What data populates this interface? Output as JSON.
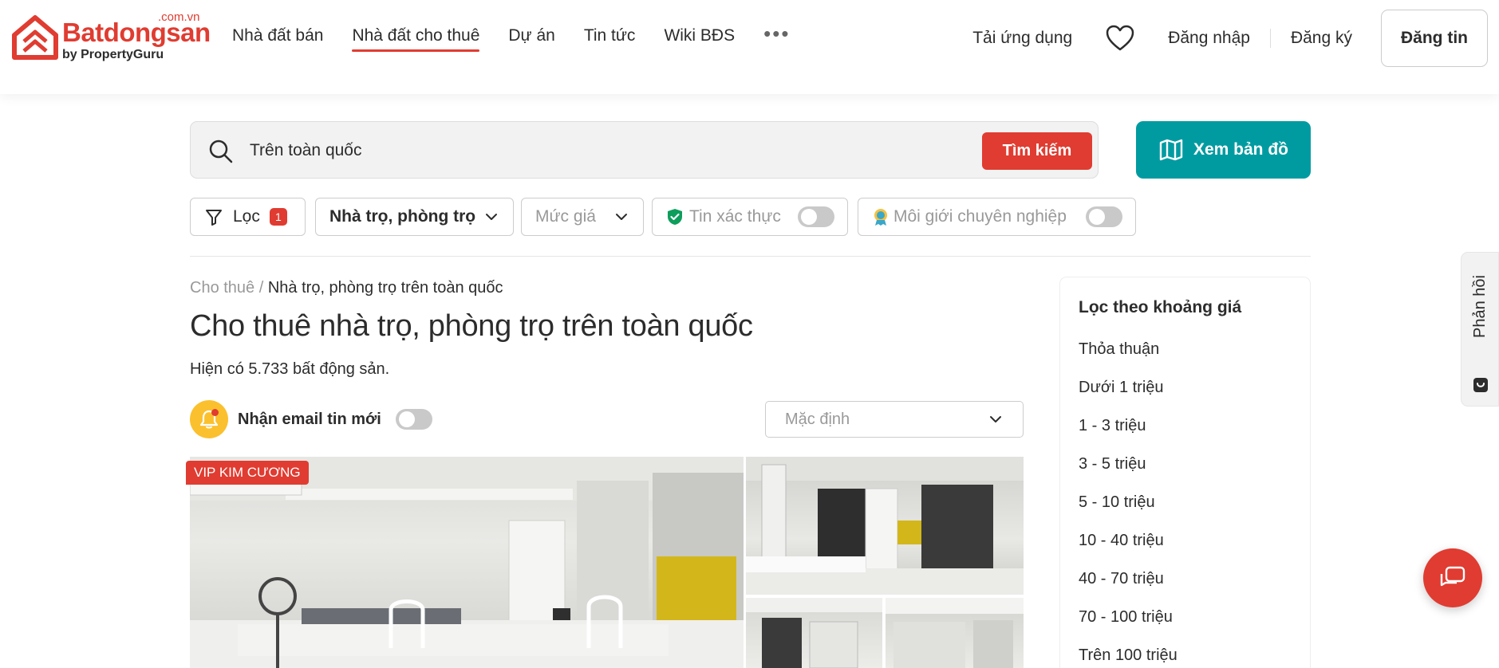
{
  "brand": {
    "name": "Batdongsan",
    "tld": ".com.vn",
    "by": "by PropertyGuru",
    "color": "#e03c31"
  },
  "nav": {
    "items": [
      {
        "label": "Nhà đất bán"
      },
      {
        "label": "Nhà đất cho thuê",
        "active": true
      },
      {
        "label": "Dự án"
      },
      {
        "label": "Tin tức"
      },
      {
        "label": "Wiki BĐS"
      }
    ],
    "more": "•••"
  },
  "header_right": {
    "app": "Tải ứng dụng",
    "login": "Đăng nhập",
    "register": "Đăng ký",
    "post": "Đăng tin"
  },
  "search": {
    "value": "Trên toàn quốc",
    "button": "Tìm kiếm",
    "map_button": "Xem bản đồ"
  },
  "filters": {
    "filter_label": "Lọc",
    "filter_count": "1",
    "category": "Nhà trọ, phòng trọ",
    "price": "Mức giá",
    "verified": "Tin xác thực",
    "pro_agent": "Môi giới chuyên nghiệp"
  },
  "breadcrumb": {
    "root": "Cho thuê",
    "sep": "/",
    "current": "Nhà trọ, phòng trọ trên toàn quốc"
  },
  "page": {
    "title": "Cho thuê nhà trọ, phòng trọ trên toàn quốc",
    "count": "Hiện có 5.733 bất động sản.",
    "notify_label": "Nhận email tin mới",
    "sort": "Mặc định"
  },
  "listing": {
    "badge": "VIP KIM CƯƠNG"
  },
  "sidebar": {
    "title": "Lọc theo khoảng giá",
    "items": [
      "Thỏa thuận",
      "Dưới 1 triệu",
      "1 - 3 triệu",
      "3 - 5 triệu",
      "5 - 10 triệu",
      "10 - 40 triệu",
      "40 - 70 triệu",
      "70 - 100 triệu",
      "Trên 100 triệu"
    ]
  },
  "feedback": {
    "label": "Phản hồi"
  },
  "colors": {
    "accent": "#e03c31",
    "teal": "#009ba1",
    "bell": "#fbc02d"
  }
}
